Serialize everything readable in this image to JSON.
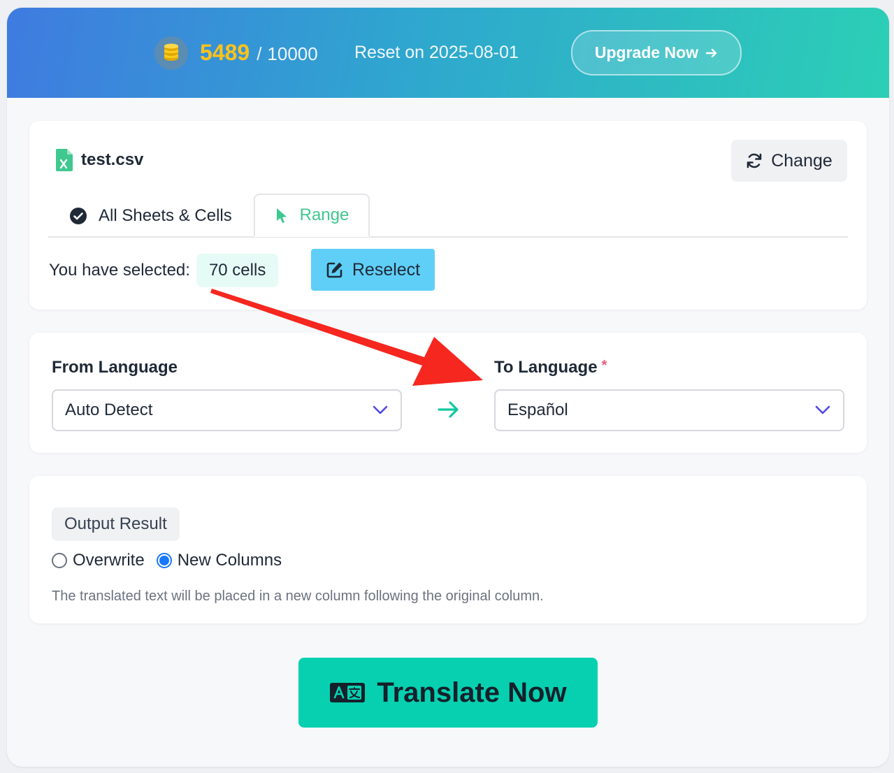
{
  "header": {
    "credits_used": "5489",
    "credits_separator": "/",
    "credits_total": "10000",
    "reset_text": "Reset on 2025-08-01",
    "upgrade_label": "Upgrade Now",
    "coin_icon": "coins-icon",
    "gradient": [
      "#3f7be0",
      "#2ccfb6"
    ],
    "credits_color": "#ffc21a"
  },
  "file": {
    "name": "test.csv",
    "icon": "excel-file-icon",
    "change_label": "Change"
  },
  "tabs": [
    {
      "label": "All Sheets & Cells",
      "icon": "check-circle-icon",
      "active": false
    },
    {
      "label": "Range",
      "icon": "cursor-pointer-icon",
      "active": true
    }
  ],
  "selection": {
    "label": "You have selected:",
    "count_label": "70 cells",
    "reselect_label": "Reselect"
  },
  "languages": {
    "from_label": "From Language",
    "from_value": "Auto Detect",
    "to_label": "To Language",
    "to_required_mark": "*",
    "to_value": "Español"
  },
  "output": {
    "section_label": "Output Result",
    "options": [
      {
        "label": "Overwrite",
        "checked": false
      },
      {
        "label": "New Columns",
        "checked": true
      }
    ],
    "hint": "The translated text will be placed in a new column following the original column."
  },
  "action": {
    "translate_label": "Translate Now",
    "icon": "translate-icon",
    "color": "#06d0b0"
  },
  "annotation_arrow_color": "#f5271f"
}
